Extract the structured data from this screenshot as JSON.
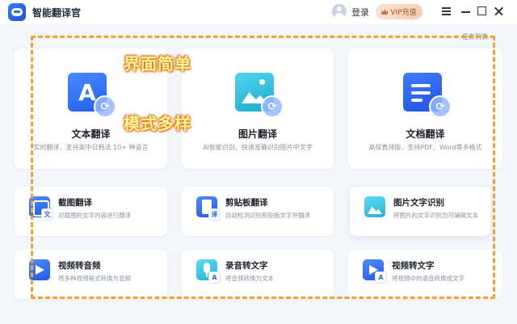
{
  "app": {
    "title": "智能翻译官"
  },
  "header": {
    "login": "登录",
    "vip_label": "VIP充值"
  },
  "task_list": "任务列表",
  "overlay": {
    "line1": "界面简单",
    "line2": "模式多样"
  },
  "big_cards": [
    {
      "title": "文本翻译",
      "desc": "实时翻译，支持英中日韩法 10+ 种语言",
      "icon_letter": "A"
    },
    {
      "title": "图片翻译",
      "desc": "AI智能识别，快速准确识别图片中文字"
    },
    {
      "title": "文档翻译",
      "desc": "高保真排版，支持PDF、Word等多格式"
    }
  ],
  "small_cards": [
    {
      "title": "截图翻译",
      "desc": "对截图的文字内容进行翻译",
      "badge": "文"
    },
    {
      "title": "剪贴板翻译",
      "desc": "自动检测识别剪贴板文字并翻译",
      "badge": "译"
    },
    {
      "title": "图片文字识别",
      "desc": "将图片的文字识别为可编辑文本"
    },
    {
      "title": "视频转音频",
      "desc": "将多种视频格式转换为音频"
    },
    {
      "title": "录音转文字",
      "desc": "将音频转换为文本",
      "badge": "A"
    },
    {
      "title": "视频转文字",
      "desc": "将视频中的语音转换成文字",
      "badge": "A"
    }
  ],
  "colors": {
    "accent": "#2e6bf0",
    "highlight": "#f2a135",
    "vip": "#a3552a"
  }
}
